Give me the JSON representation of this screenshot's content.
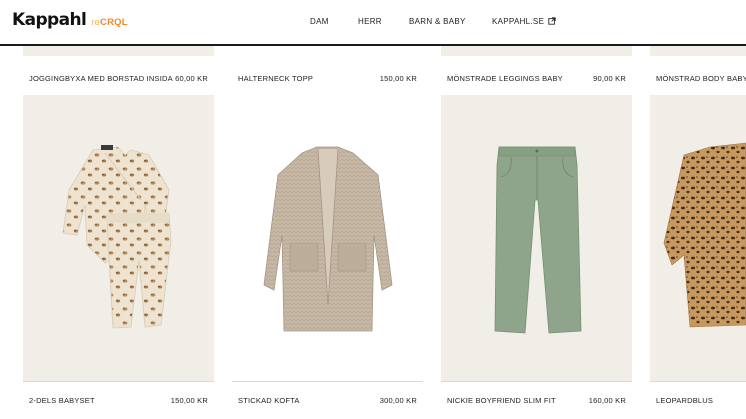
{
  "brand": {
    "name": "Kappahl",
    "sub_prefix": "re",
    "sub_main": "CRQL",
    "colors": {
      "sub_prefix": "#f7b35c",
      "sub_main": "#ef8a2a"
    }
  },
  "nav": [
    {
      "label": "DAM"
    },
    {
      "label": "HERR"
    },
    {
      "label": "BARN & BABY"
    },
    {
      "label": "KAPPAHL.SE",
      "icon": "external-link-icon"
    }
  ],
  "top_row": [
    {
      "name": "JOGGINGBYXA MED BORSTAD INSIDA",
      "price": "60,00 KR"
    },
    {
      "name": "HALTERNECK TOPP",
      "price": "150,00 KR"
    },
    {
      "name": "MÖNSTRADE LEGGINGS BABY",
      "price": "90,00 KR"
    },
    {
      "name": "MÖNSTRAD BODY BABY",
      "price": ""
    }
  ],
  "products": [
    {
      "name": "2-DELS BABYSET",
      "price": "150,00 KR",
      "image": "baby-set-image"
    },
    {
      "name": "STICKAD KOFTA",
      "price": "300,00 KR",
      "image": "knit-cardigan-image"
    },
    {
      "name": "NICKIE BOYFRIEND SLIM FIT",
      "price": "160,00 KR",
      "image": "green-trousers-image"
    },
    {
      "name": "LEOPARDBLUS",
      "price": "",
      "image": "leopard-blouse-image"
    }
  ],
  "colors": {
    "image_bg": "#f1ede7",
    "accent": "#1a1a1a"
  }
}
